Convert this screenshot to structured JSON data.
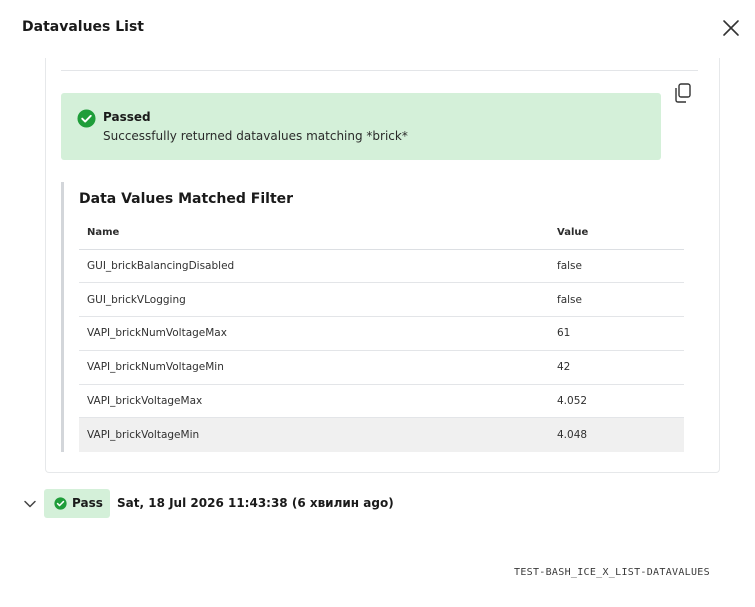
{
  "dialog": {
    "title": "Datavalues List",
    "close_icon": "close-icon"
  },
  "alert": {
    "status_icon": "check-circle-icon",
    "title": "Passed",
    "message": "Successfully returned datavalues matching *brick*"
  },
  "copy_icon": "copy-icon",
  "panel": {
    "title": "Data Values Matched Filter",
    "columns": [
      "Name",
      "Value"
    ],
    "rows": [
      {
        "name": "GUI_brickBalancingDisabled",
        "value": "false"
      },
      {
        "name": "GUI_brickVLogging",
        "value": "false"
      },
      {
        "name": "VAPI_brickNumVoltageMax",
        "value": "61"
      },
      {
        "name": "VAPI_brickNumVoltageMin",
        "value": "42"
      },
      {
        "name": "VAPI_brickVoltageMax",
        "value": "4.052"
      },
      {
        "name": "VAPI_brickVoltageMin",
        "value": "4.048"
      }
    ]
  },
  "result": {
    "expand_icon": "chevron-down-icon",
    "badge_label": "Pass",
    "timestamp": "Sat, 18 Jul 2026 11:43:38 (6 хвилин ago)"
  },
  "test_id": "TEST-BASH_ICE_X_LIST-DATAVALUES",
  "colors": {
    "success_bg": "#d4f0d9",
    "success_icon": "#1f9d3a",
    "border": "#e3e5e8",
    "panel_rule": "#d3d6da"
  }
}
